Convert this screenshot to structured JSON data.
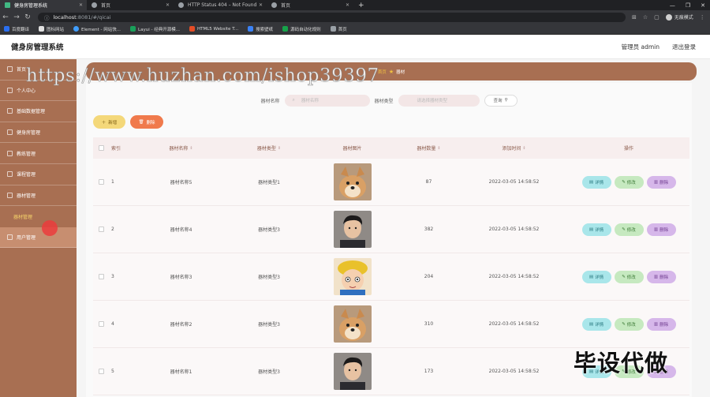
{
  "browser": {
    "tabs": [
      {
        "label": "健身房管理系统",
        "active": true,
        "favicon_color": "#41b883"
      },
      {
        "label": "首页",
        "active": false,
        "favicon_color": "#9aa0a6"
      },
      {
        "label": "HTTP Status 404 – Not Found",
        "active": false,
        "favicon_color": "#9aa0a6"
      },
      {
        "label": "首页",
        "active": false,
        "favicon_color": "#9aa0a6"
      }
    ],
    "url_host": "localhost",
    "url_path": ":8081/#/qicai",
    "profile_label": "无痕模式",
    "bookmarks": [
      {
        "label": "百度翻译",
        "color": "#2a6ff0"
      },
      {
        "label": "图标网站",
        "color": "#222222"
      },
      {
        "label": "Element - 网站快...",
        "color": "#409eff"
      },
      {
        "label": "Layui - 经典开源模...",
        "color": "#19a05a"
      },
      {
        "label": "HTML5 Website T...",
        "color": "#e44d26"
      },
      {
        "label": "搜索壁纸",
        "color": "#3b82f6"
      },
      {
        "label": "源码自动化规则",
        "color": "#16a34a"
      },
      {
        "label": "首页",
        "color": "#9aa0a6"
      }
    ]
  },
  "header": {
    "title": "健身房管理系统",
    "admin": "管理员 admin",
    "logout": "退出登录"
  },
  "sidebar": {
    "items": [
      {
        "label": "首页"
      },
      {
        "label": "个人中心"
      },
      {
        "label": "基础数据管理"
      },
      {
        "label": "健身房管理"
      },
      {
        "label": "教练管理"
      },
      {
        "label": "课程管理"
      },
      {
        "label": "器材管理"
      }
    ],
    "sub_item": "器材管理",
    "hover_item": "用户管理"
  },
  "breadcrumb": {
    "home": "首页",
    "current": "器材"
  },
  "search": {
    "name_label": "器材名称",
    "name_placeholder": "器材名称",
    "type_label": "器材类型",
    "type_placeholder": "请选择器材类型",
    "button": "查询"
  },
  "actions": {
    "add": "新增",
    "delete": "删除"
  },
  "table": {
    "headers": {
      "idx": "索引",
      "name": "器材名称",
      "type": "器材类型",
      "img": "器材图片",
      "num": "器材数量",
      "time": "添加时间",
      "ops": "操作"
    },
    "op_labels": {
      "detail": "详情",
      "edit": "修改",
      "delete": "删除"
    },
    "rows": [
      {
        "idx": "1",
        "name": "器材名称5",
        "type": "器材类型1",
        "num": "87",
        "time": "2022-03-05 14:58:52",
        "img": "dog"
      },
      {
        "idx": "2",
        "name": "器材名称4",
        "type": "器材类型3",
        "num": "382",
        "time": "2022-03-05 14:58:52",
        "img": "man"
      },
      {
        "idx": "3",
        "name": "器材名称3",
        "type": "器材类型3",
        "num": "204",
        "time": "2022-03-05 14:58:52",
        "img": "cartoon"
      },
      {
        "idx": "4",
        "name": "器材名称2",
        "type": "器材类型3",
        "num": "310",
        "time": "2022-03-05 14:58:52",
        "img": "dog"
      },
      {
        "idx": "5",
        "name": "器材名称1",
        "type": "器材类型3",
        "num": "173",
        "time": "2022-03-05 14:58:52",
        "img": "man"
      }
    ]
  },
  "overlays": {
    "watermark": "https://www.huzhan.com/ishop39397",
    "stamp": "毕设代做"
  },
  "colors": {
    "sidebar": "#a86f52",
    "add_button": "#f4d87a",
    "delete_button": "#f07a4c",
    "detail_button": "#a9e6ea",
    "edit_button": "#c6e9c0",
    "row_delete_button": "#d6b7ea"
  }
}
